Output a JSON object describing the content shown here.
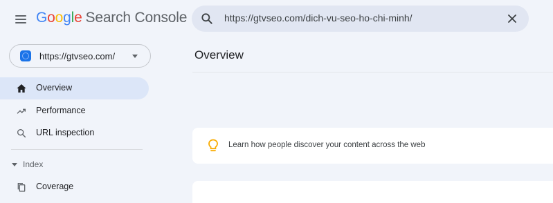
{
  "header": {
    "logo_letters": [
      "G",
      "o",
      "o",
      "g",
      "l",
      "e"
    ],
    "product_name": "Search Console",
    "search_value": "https://gtvseo.com/dich-vu-seo-ho-chi-minh/",
    "icons": {
      "menu": "menu-icon",
      "search": "search-icon",
      "clear": "close-icon"
    }
  },
  "sidebar": {
    "property": {
      "label": "https://gtvseo.com/",
      "icon": "property-icon"
    },
    "items": [
      {
        "label": "Overview",
        "icon": "home-icon",
        "active": true
      },
      {
        "label": "Performance",
        "icon": "trending-up-icon",
        "active": false
      },
      {
        "label": "URL inspection",
        "icon": "search-icon",
        "active": false
      }
    ],
    "section": {
      "label": "Index"
    },
    "section_items": [
      {
        "label": "Coverage",
        "icon": "copy-icon"
      }
    ]
  },
  "main": {
    "title": "Overview",
    "tip": "Learn how people discover your content across the web"
  },
  "colors": {
    "background": "#f1f4fa",
    "active_nav": "#dce6f8",
    "search_bg": "#e1e6f2",
    "bulb": "#f9ab00"
  }
}
